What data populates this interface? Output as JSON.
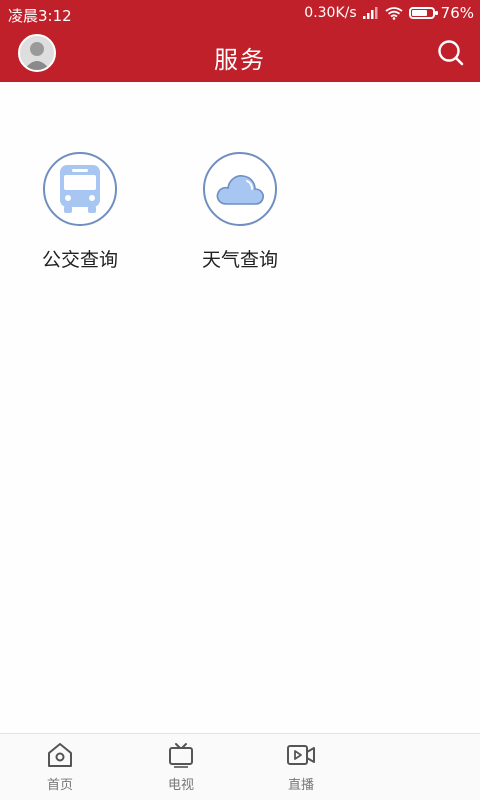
{
  "status_bar": {
    "time": "凌晨3:12",
    "net_speed": "0.30K/s",
    "battery_percent": "76%",
    "battery_level": 0.76
  },
  "header": {
    "title": "服务"
  },
  "services": [
    {
      "label": "公交查询",
      "icon": "bus-icon"
    },
    {
      "label": "天气查询",
      "icon": "cloud-icon"
    }
  ],
  "bottom_nav": [
    {
      "label": "首页",
      "icon": "home-icon"
    },
    {
      "label": "电视",
      "icon": "tv-icon"
    },
    {
      "label": "直播",
      "icon": "video-icon"
    }
  ],
  "colors": {
    "brand_red": "#c0202a",
    "icon_blue": "#a8c6f2",
    "ring_blue": "#6f8fc0"
  }
}
